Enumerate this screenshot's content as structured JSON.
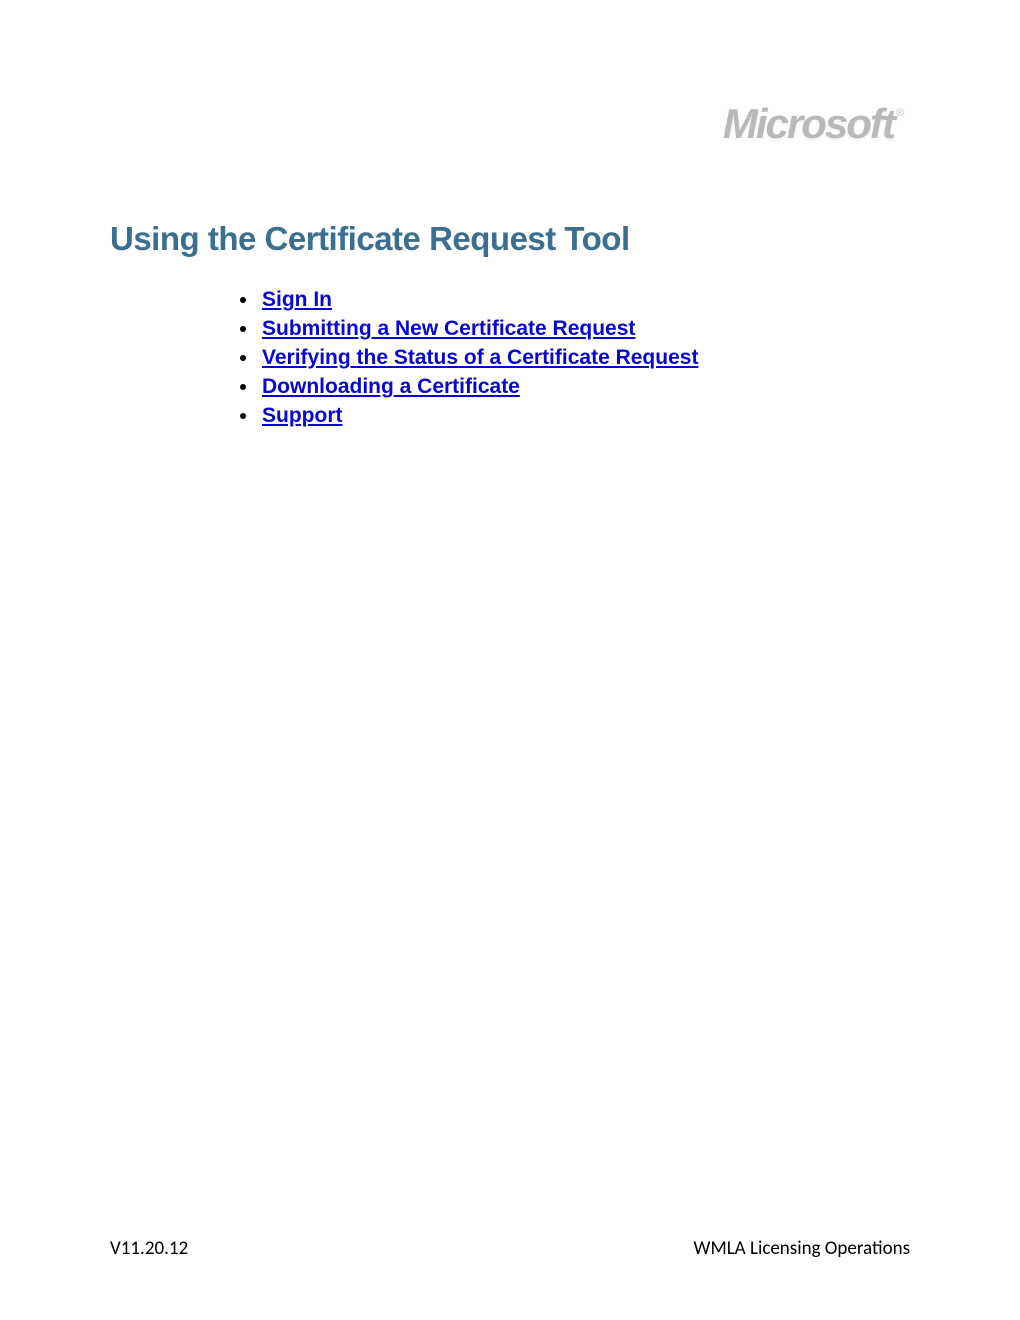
{
  "header": {
    "logo_text": "Microsoft",
    "logo_reg": "®"
  },
  "title": "Using the Certificate Request Tool",
  "toc": [
    {
      "label": "Sign In"
    },
    {
      "label": "Submitting a New Certificate Request"
    },
    {
      "label": "Verifying the Status of a Certificate Request"
    },
    {
      "label": "Downloading a Certificate"
    },
    {
      "label": "Support"
    }
  ],
  "footer": {
    "version": "V11.20.12",
    "org": "WMLA Licensing Operations"
  },
  "colors": {
    "title": "#3b6e8f",
    "link": "#0707d1",
    "logo": "#b9b9b9"
  }
}
